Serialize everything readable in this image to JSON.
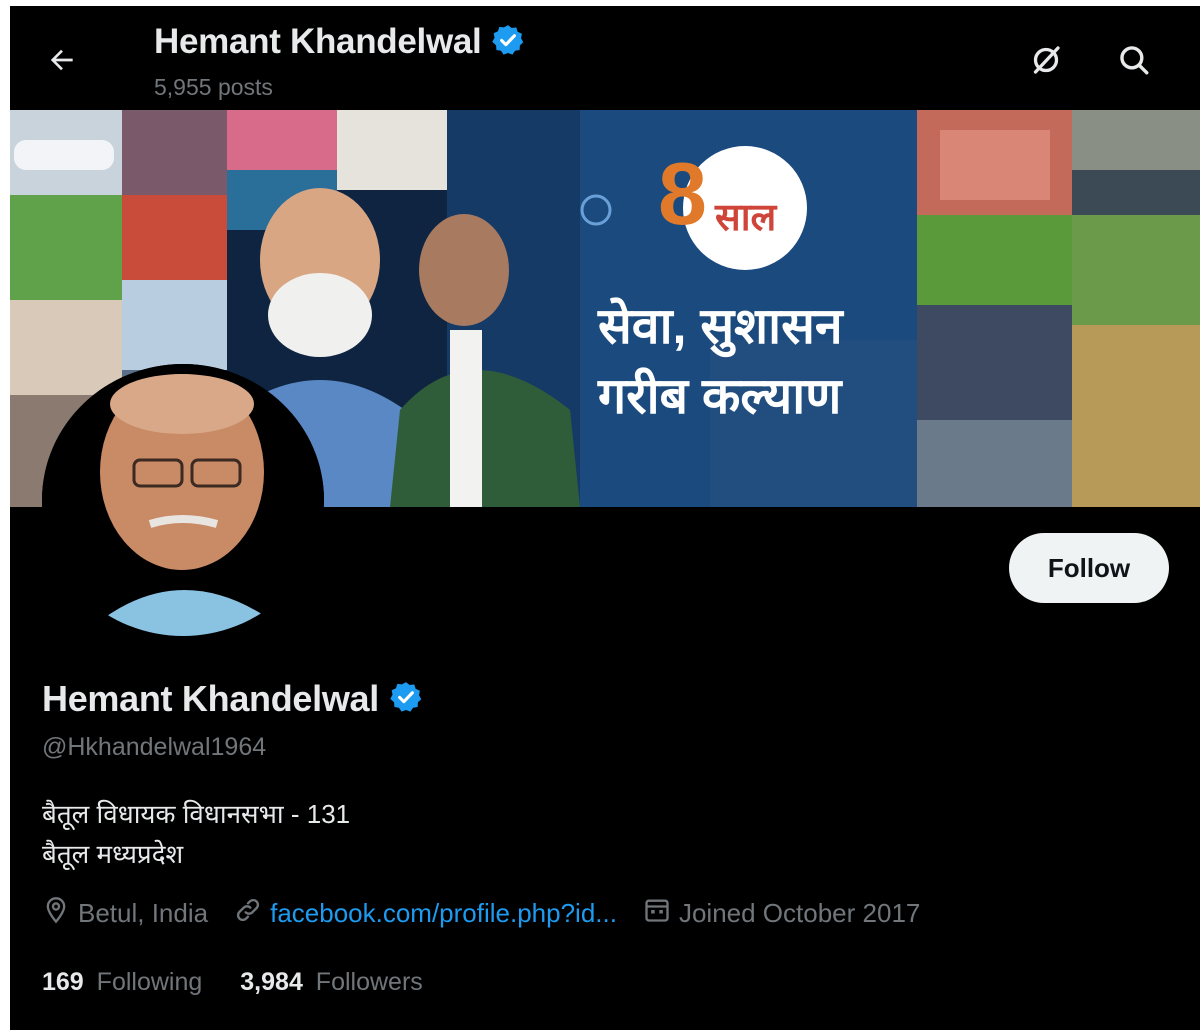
{
  "header": {
    "name": "Hemant Khandelwal",
    "posts": "5,955 posts"
  },
  "banner": {
    "badge_text": "साल",
    "badge_number": "8",
    "headline_line1": "सेवा, सुशासन",
    "headline_line2": "गरीब कल्याण"
  },
  "profile": {
    "name": "Hemant Khandelwal",
    "handle": "@Hkhandelwal1964",
    "bio_line1": "बैतूल विधायक विधानसभा - 131",
    "bio_line2": "बैतूल मध्यप्रदेश",
    "location": "Betul, India",
    "website": "facebook.com/profile.php?id...",
    "joined": "Joined October 2017",
    "following_count": "169",
    "following_label": "Following",
    "followers_count": "3,984",
    "followers_label": "Followers"
  },
  "actions": {
    "follow_label": "Follow"
  },
  "icons": {
    "back": "back-arrow-icon",
    "grok": "grok-icon",
    "search": "search-icon",
    "verified": "verified-badge-icon",
    "location": "location-pin-icon",
    "link": "link-icon",
    "calendar": "calendar-icon"
  },
  "colors": {
    "background": "#000000",
    "text_primary": "#e7e9ea",
    "text_secondary": "#71767b",
    "accent": "#1d9bf0",
    "follow_button_bg": "#eff3f4"
  }
}
